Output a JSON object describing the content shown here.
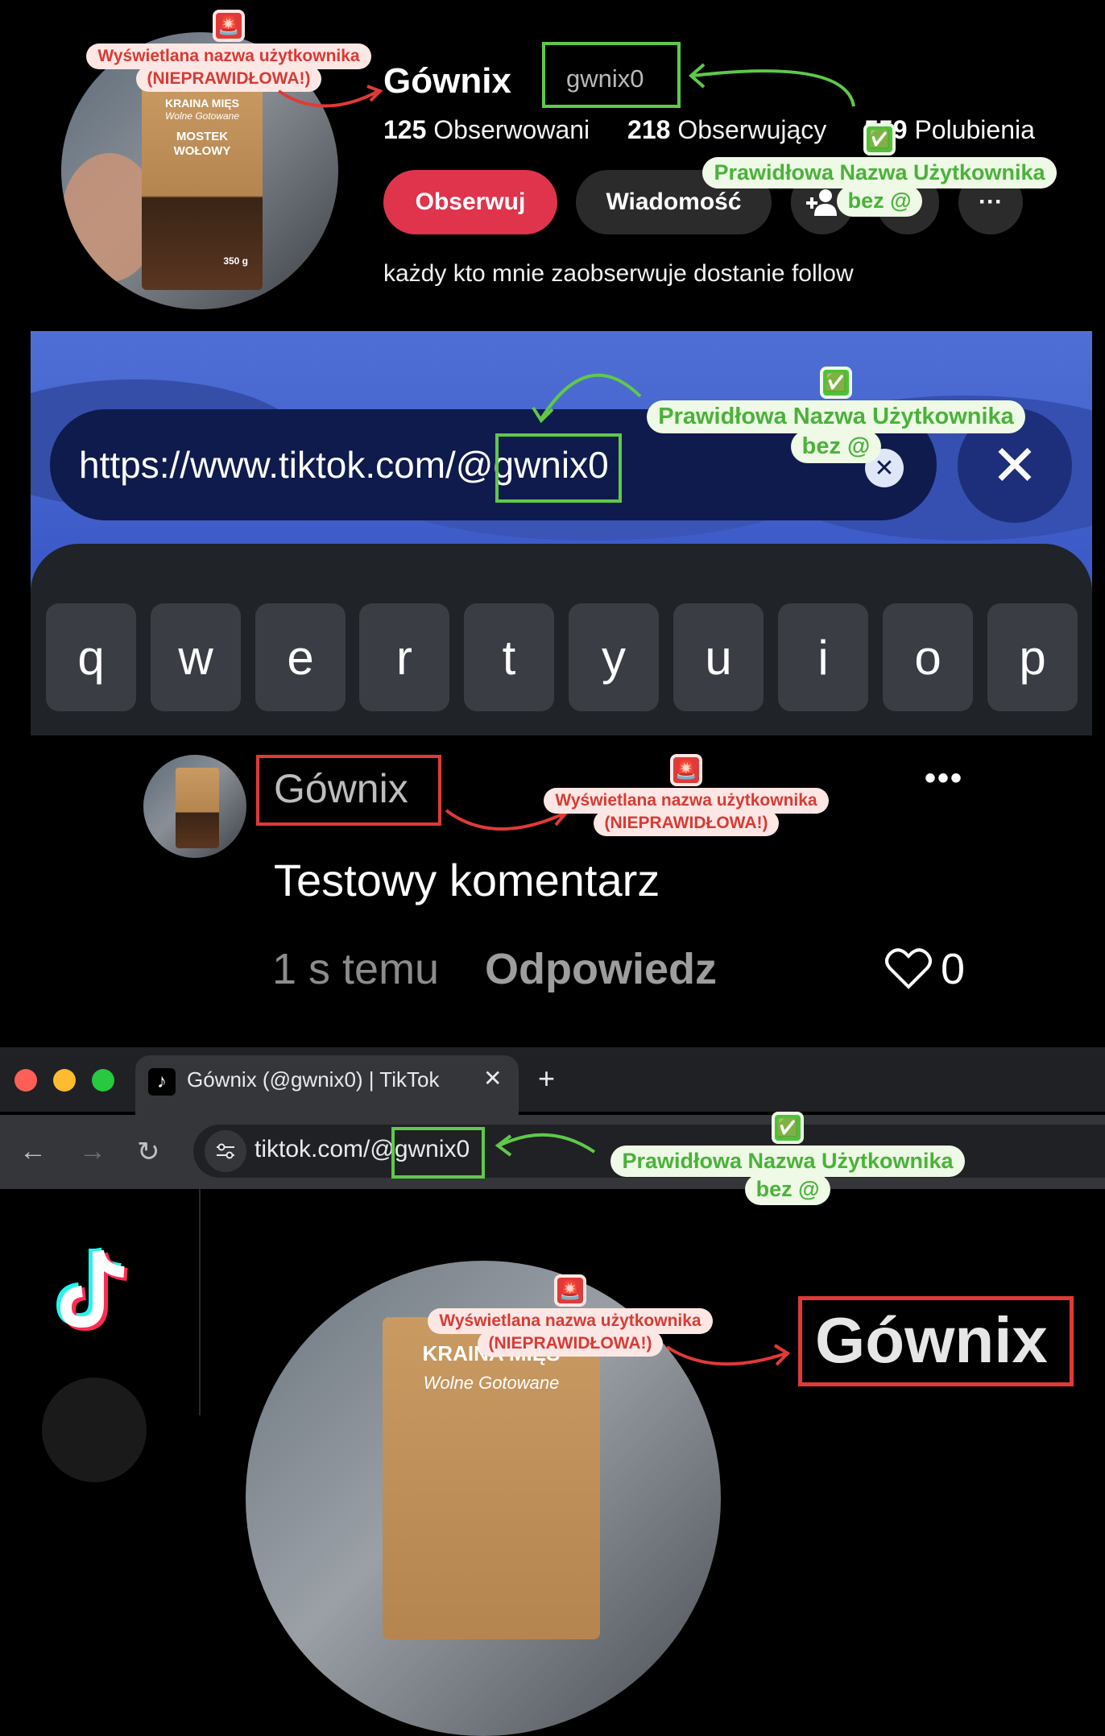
{
  "profile": {
    "display_name": "Gównix",
    "username": "gwnix0",
    "stats": {
      "following_count": "125",
      "following_label": "Obserwowani",
      "followers_count": "218",
      "followers_label": "Obserwujący",
      "likes_count": "559",
      "likes_label": "Polubienia"
    },
    "follow_label": "Obserwuj",
    "message_label": "Wiadomość",
    "more_label": "···",
    "bio": "każdy kto mnie zaobserwuje dostanie follow",
    "avatar_product": {
      "brand": "KRAINA MIĘS",
      "line": "Wolne Gotowane",
      "name": "MOSTEK WOŁOWY",
      "weight": "350 g"
    }
  },
  "mobile_url": {
    "prefix": "https://www.tiktok.com/@",
    "username": "gwnix0",
    "clear_icon": "✕",
    "close_icon": "✕"
  },
  "keyboard": {
    "keys": [
      "q",
      "w",
      "e",
      "r",
      "t",
      "y",
      "u",
      "i",
      "o",
      "p"
    ]
  },
  "comment": {
    "author": "Gównix",
    "more_label": "•••",
    "text": "Testowy komentarz",
    "time": "1 s temu",
    "reply_label": "Odpowiedz",
    "likes": "0"
  },
  "browser": {
    "tab_title": "Gównix (@gwnix0) | TikTok",
    "tab_close": "✕",
    "new_tab": "+",
    "back_icon": "←",
    "forward_icon": "→",
    "reload_icon": "↻",
    "omnibox_prefix": "tiktok.com/@",
    "omnibox_username": "gwnix0",
    "display_name": "Gównix",
    "avatar_brand": "KRAINA MIĘS",
    "avatar_line": "Wolne Gotowane"
  },
  "annotations": {
    "wrong_line1": "Wyświetlana nazwa użytkownika",
    "wrong_line2": "(NIEPRAWIDŁOWA!)",
    "right_line1": "Prawidłowa Nazwa Użytkownika",
    "right_line2": "bez @",
    "wrong_badge": "🚨",
    "right_badge": "✅"
  },
  "colors": {
    "follow_red": "#e0344c",
    "highlight_green": "#5fc94a",
    "highlight_red": "#e03a38",
    "mobile_bg_blue": "#4f6fd6"
  }
}
